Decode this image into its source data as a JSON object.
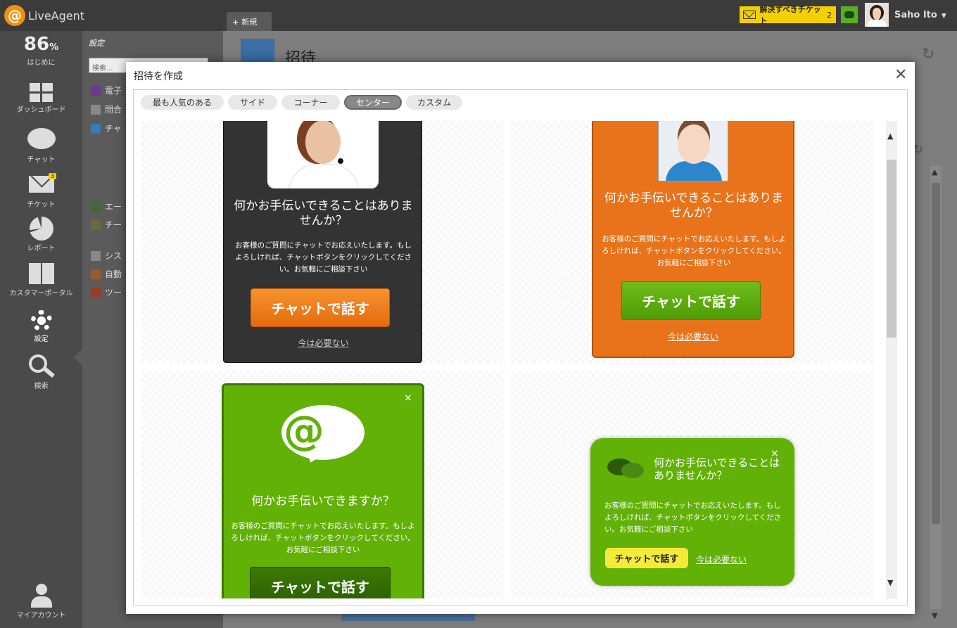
{
  "app": {
    "name": "LiveAgent",
    "logo_glyph": "@"
  },
  "topbar": {
    "new_tab_label": "新規",
    "ticket_alert": {
      "label": "解決すべきチケット",
      "count": "2",
      "color": "#f5d000"
    },
    "chat_icon_color": "#57b024",
    "user_name": "Saho Ito"
  },
  "left_nav": {
    "progress_value": "86",
    "progress_unit": "%",
    "items": [
      {
        "label": "はじめに",
        "icon": "progress"
      },
      {
        "label": "ダッシュボード",
        "icon": "dashboard-icon"
      },
      {
        "label": "チャット",
        "icon": "chat-bubble-icon"
      },
      {
        "label": "チケット",
        "icon": "envelope-icon",
        "badge": "3"
      },
      {
        "label": "レポート",
        "icon": "pie-chart-icon"
      },
      {
        "label": "カスタマーポータル",
        "icon": "book-icon"
      },
      {
        "label": "設定",
        "icon": "gear-icon",
        "active": true
      },
      {
        "label": "検索",
        "icon": "search-icon"
      },
      {
        "label": "マイアカウント",
        "icon": "person-icon"
      }
    ]
  },
  "settings_panel": {
    "title": "設定",
    "search_placeholder": "検索...",
    "items": [
      "電子",
      "問合",
      "チャ",
      "エー",
      "チー",
      "シス",
      "自動",
      "ツー"
    ]
  },
  "page": {
    "title": "招待"
  },
  "modal": {
    "title": "招待を作成",
    "close_glyph": "✕",
    "tabs": [
      {
        "label": "最も人気のある",
        "active": false
      },
      {
        "label": "サイド",
        "active": false
      },
      {
        "label": "コーナー",
        "active": false
      },
      {
        "label": "センター",
        "active": true
      },
      {
        "label": "カスタム",
        "active": false
      }
    ],
    "templates": [
      {
        "style": "dark",
        "heading": "何かお手伝いできることはありませんか？",
        "body": "お客様のご質問にチャットでお応えいたします。もしよろしければ、チャットボタンをクリックしてください。お気軽にご相談下さい",
        "button": "チャットで話す",
        "dismiss": "今は必要ない",
        "colors": {
          "bg": "#333333",
          "button": "#e46c0c"
        }
      },
      {
        "style": "orange",
        "heading": "何かお手伝いできることはありませんか？",
        "body": "お客様のご質問にチャットでお応えいたします。もしよろしければ、チャットボタンをクリックしてください。お気軽にご相談下さい",
        "button": "チャットで話す",
        "dismiss": "今は必要ない",
        "colors": {
          "bg": "#e8731a",
          "button": "#4f9c06"
        }
      },
      {
        "style": "green-logo",
        "heading": "何かお手伝いできますか？",
        "body": "お客様のご質問にチャットでお応えいたします。もしよろしければ、チャットボタンをクリックしてください。お気軽にご相談下さい",
        "button": "チャットで話す",
        "close_glyph": "×",
        "logo_glyph": "@",
        "colors": {
          "bg": "#62b107",
          "button": "#2b5d02"
        }
      },
      {
        "style": "green-compact",
        "heading": "何かお手伝いできることはありませんか？",
        "body": "お客様のご質問にチャットでお応えいたします。もしよろしければ、チャットボタンをクリックしてください。お気軽にご相談下さい",
        "button": "チャットで話す",
        "dismiss": "今は必要ない",
        "close_glyph": "×",
        "colors": {
          "bg": "#62b107",
          "button": "#f5ea3a"
        }
      }
    ]
  }
}
